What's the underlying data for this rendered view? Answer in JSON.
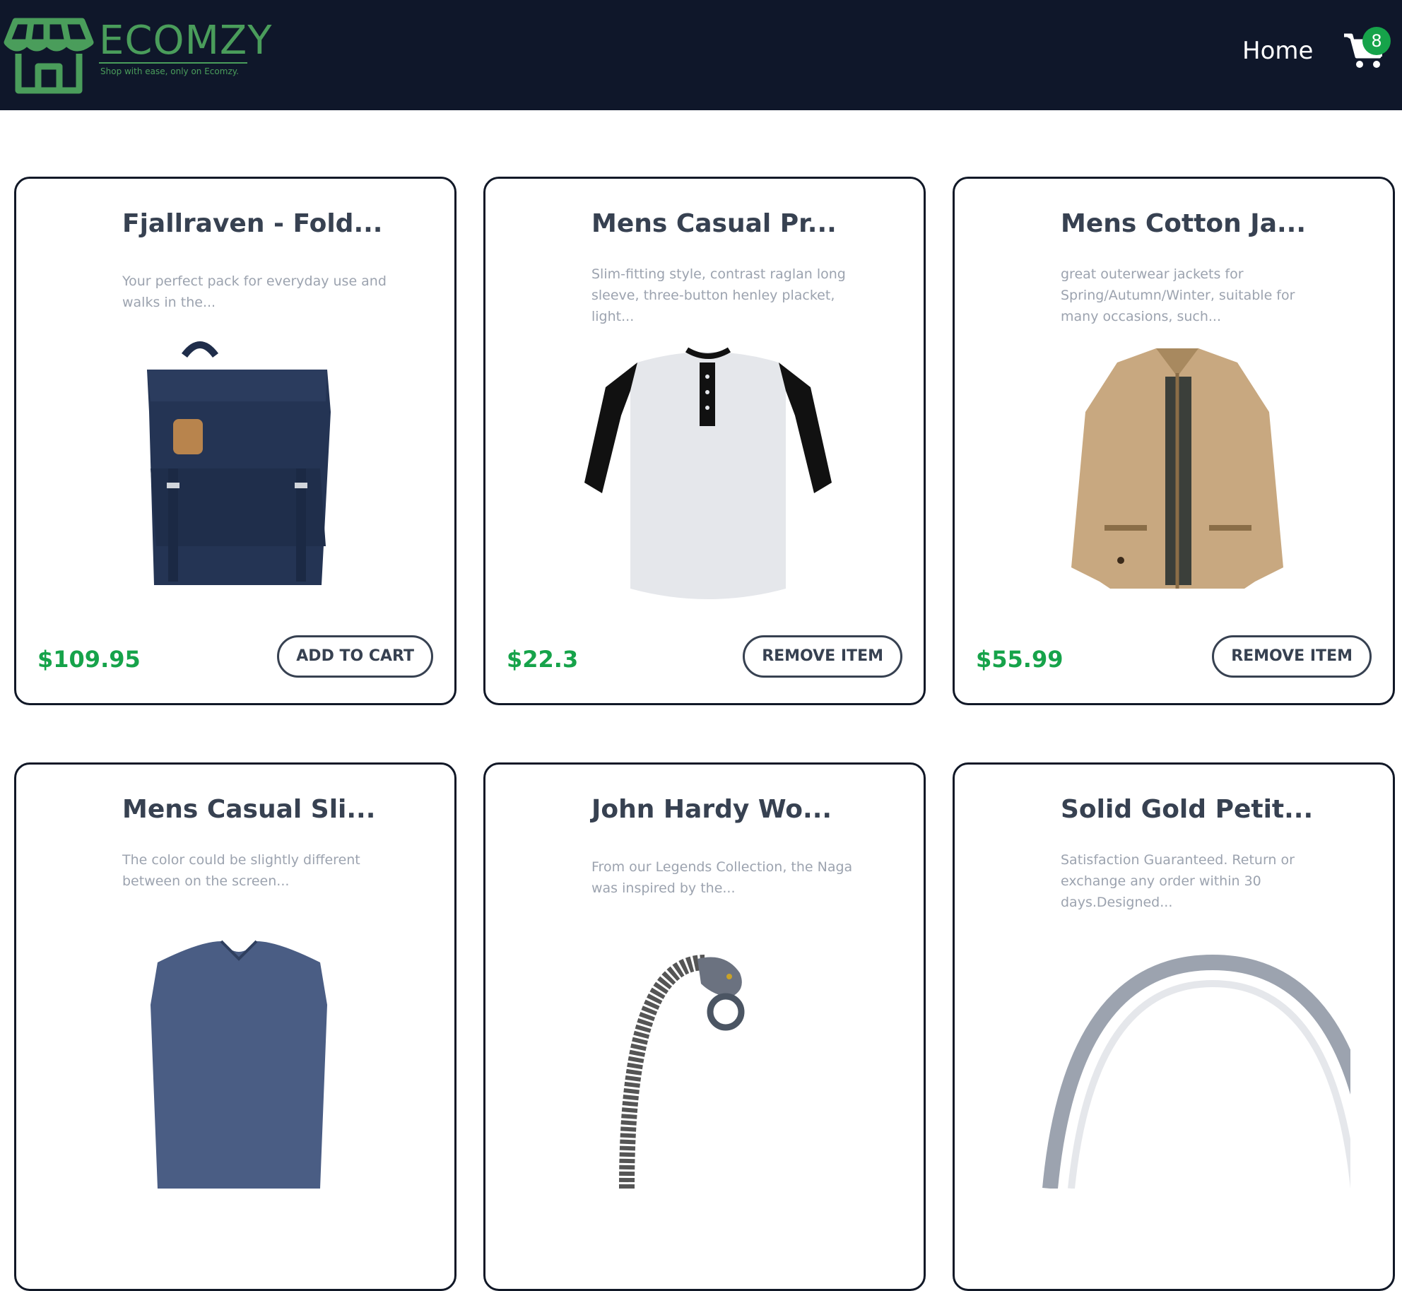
{
  "header": {
    "logo_text": "ECOMZY",
    "logo_tagline": "Shop with ease, only on Ecomzy.",
    "nav_home": "Home",
    "cart_count": "8",
    "colors": {
      "background": "#0f172a",
      "logo": "#4a9d5b",
      "badge": "#16a34a"
    }
  },
  "products": [
    {
      "title": "Fjallraven - Fold...",
      "description": "Your perfect pack for everyday use and walks in the...",
      "price": "$109.95",
      "button": "ADD TO CART",
      "image_icon": "backpack-image"
    },
    {
      "title": "Mens Casual Pr...",
      "description": "Slim-fitting style, contrast raglan long sleeve, three-button henley placket, light...",
      "price": "$22.3",
      "button": "REMOVE ITEM",
      "image_icon": "henley-shirt-image"
    },
    {
      "title": "Mens Cotton Ja...",
      "description": "great outerwear jackets for Spring/Autumn/Winter, suitable for many occasions, such...",
      "price": "$55.99",
      "button": "REMOVE ITEM",
      "image_icon": "jacket-image"
    },
    {
      "title": "Mens Casual Sli...",
      "description": "The color could be slightly different between on the screen...",
      "image_icon": "tshirt-image"
    },
    {
      "title": "John Hardy Wo...",
      "description": "From our Legends Collection, the Naga was inspired by the...",
      "image_icon": "bracelet-image"
    },
    {
      "title": "Solid Gold Petit...",
      "description": "Satisfaction Guaranteed. Return or exchange any order within 30 days.Designed...",
      "image_icon": "ring-image"
    }
  ]
}
